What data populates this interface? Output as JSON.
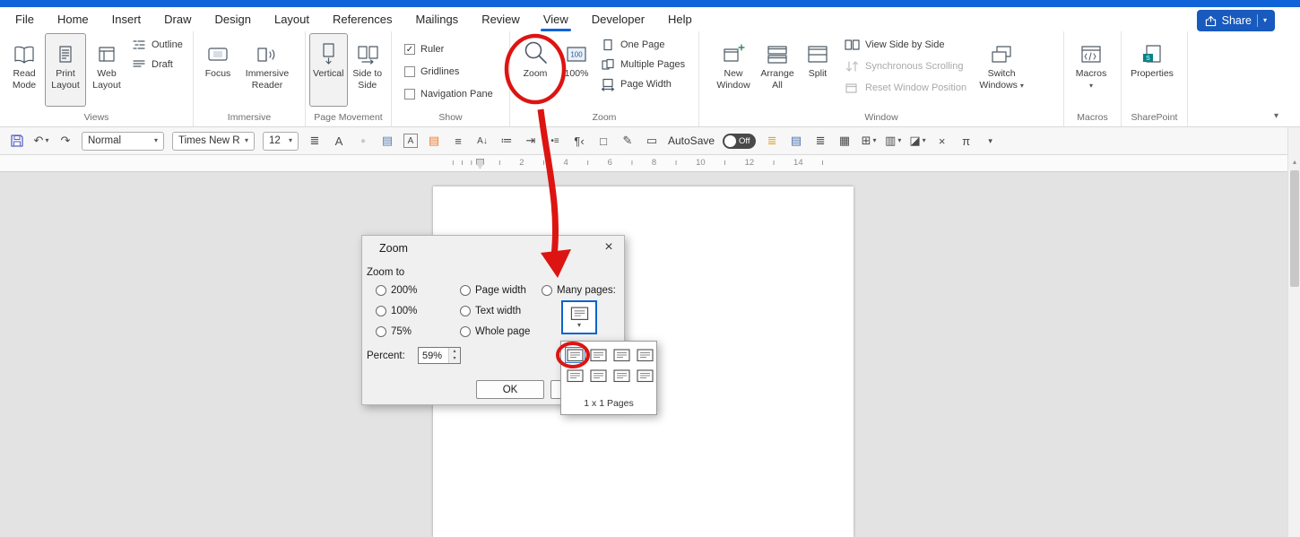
{
  "colors": {
    "titlebar_blue": "#1164d8",
    "tab_underline": "#1164d8",
    "accent_blue": "#185abd",
    "annotation_red": "#dc1512",
    "properties_teal": "#038387",
    "page_color_orange": "#ed7d31",
    "highlight_orange": "#f0a01e",
    "toggle_bg": "#494949"
  },
  "menu": {
    "tabs": [
      "File",
      "Home",
      "Insert",
      "Draw",
      "Design",
      "Layout",
      "References",
      "Mailings",
      "Review",
      "View",
      "Developer",
      "Help"
    ],
    "active_tab": "View",
    "share": "Share"
  },
  "ribbon": {
    "groups": {
      "views": {
        "label": "Views",
        "items": [
          "Read Mode",
          "Print Layout",
          "Web Layout",
          "Outline",
          "Draft"
        ]
      },
      "immersive": {
        "label": "Immersive",
        "items": [
          "Focus",
          "Immersive Reader"
        ]
      },
      "page_movement": {
        "label": "Page Movement",
        "items": [
          "Vertical",
          "Side to Side"
        ]
      },
      "show": {
        "label": "Show",
        "items": [
          "Ruler",
          "Gridlines",
          "Navigation Pane"
        ],
        "ruler_checked": true
      },
      "zoom": {
        "label": "Zoom",
        "items": [
          "Zoom",
          "100%",
          "One Page",
          "Multiple Pages",
          "Page Width"
        ]
      },
      "window": {
        "label": "Window",
        "items": [
          "New Window",
          "Arrange All",
          "Split",
          "View Side by Side",
          "Synchronous Scrolling",
          "Reset Window Position",
          "Switch Windows"
        ]
      },
      "macros": {
        "label": "Macros",
        "items": [
          "Macros"
        ]
      },
      "sharepoint": {
        "label": "SharePoint",
        "items": [
          "Properties"
        ]
      }
    }
  },
  "qat": {
    "style_value": "Normal",
    "font_value": "Times New R",
    "size_value": "12",
    "autosave_label": "AutoSave",
    "autosave_state": "Off",
    "icon_glyphs": [
      "≣",
      "A",
      "●",
      "▤",
      "A",
      "▤",
      "≡",
      "A↓",
      "≔",
      "⇥",
      "•≡",
      "¶‹",
      "□",
      "✎",
      "▭"
    ],
    "icon_glyphs2": [
      "≣",
      "▤",
      "≣",
      "▦",
      "⊞",
      "▥",
      "◪",
      "×",
      "π"
    ]
  },
  "ruler": {
    "left_marks": "ı ı ı ı",
    "right_marks": "ı 2 ı 4 ı 6 ı 8 ı 10 ı 12 ı 14 ı"
  },
  "dialog": {
    "title": "Zoom",
    "group_label": "Zoom to",
    "radios": {
      "r200": "200%",
      "r100": "100%",
      "r75": "75%",
      "page_width": "Page width",
      "text_width": "Text width",
      "whole_page": "Whole page",
      "many_pages": "Many pages:"
    },
    "percent_label": "Percent:",
    "percent_value": "59%",
    "ok_label": "OK"
  },
  "pages_dropdown": {
    "caption": "1 x 1 Pages"
  },
  "icons": {
    "chevron_down": "▾",
    "chevron_up": "▴",
    "undo": "↶",
    "redo": "↷",
    "close": "×",
    "check": "✓",
    "zoom_100": "100",
    "properties_glyph": "S",
    "spin_up": "▴",
    "spin_down": "▾"
  }
}
